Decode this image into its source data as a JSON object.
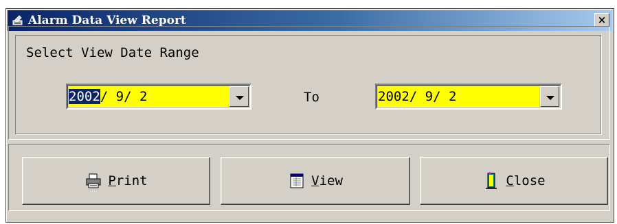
{
  "window": {
    "title": "Alarm Data View Report",
    "close_glyph": "×"
  },
  "date_range": {
    "group_label": "Select View Date Range",
    "from": {
      "selected": "2002",
      "rest": "/ 9/ 2"
    },
    "to_label": "To",
    "to": {
      "value": "2002/ 9/ 2"
    }
  },
  "buttons": [
    {
      "mnemonic": "P",
      "rest": "rint",
      "icon": "printer-icon"
    },
    {
      "mnemonic": "V",
      "rest": "iew",
      "icon": "view-icon"
    },
    {
      "mnemonic": "C",
      "rest": "lose",
      "icon": "door-icon"
    }
  ],
  "colors": {
    "field_bg": "#ffff00",
    "selection_bg": "#0a246a",
    "titlebar_left": "#0a246a",
    "titlebar_right": "#a6caf0"
  }
}
